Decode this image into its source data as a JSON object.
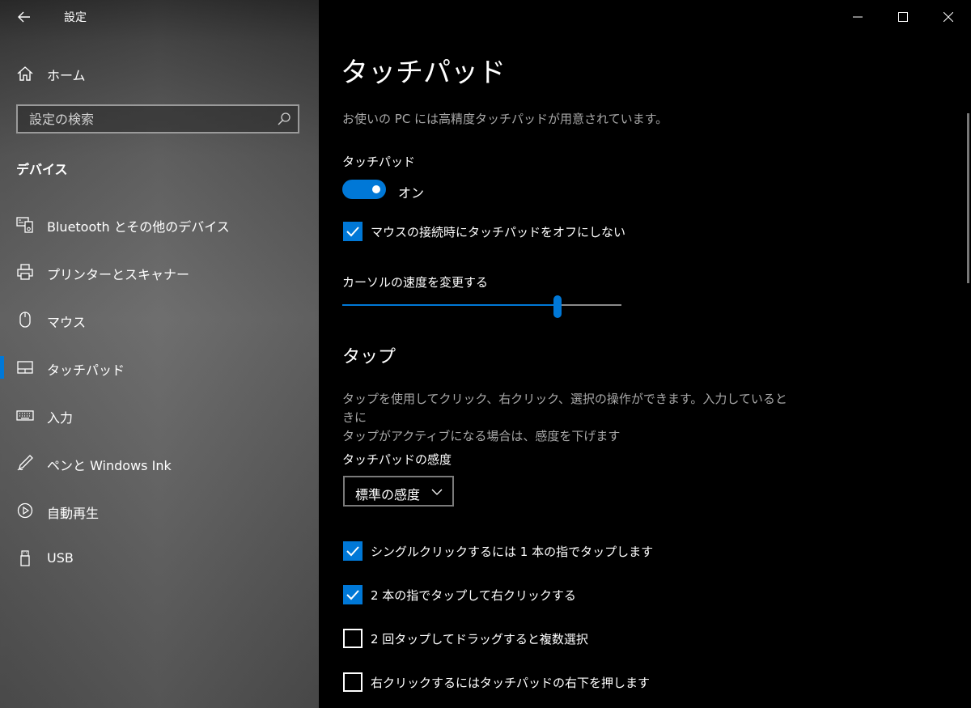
{
  "window": {
    "title": "設定"
  },
  "sidebar": {
    "home_label": "ホーム",
    "search_placeholder": "設定の検索",
    "section": "デバイス",
    "items": [
      {
        "label": "Bluetooth とその他のデバイス",
        "icon": "bluetooth-devices-icon",
        "active": false
      },
      {
        "label": "プリンターとスキャナー",
        "icon": "printer-icon",
        "active": false
      },
      {
        "label": "マウス",
        "icon": "mouse-icon",
        "active": false
      },
      {
        "label": "タッチパッド",
        "icon": "touchpad-icon",
        "active": true
      },
      {
        "label": "入力",
        "icon": "keyboard-icon",
        "active": false
      },
      {
        "label": "ペンと Windows Ink",
        "icon": "pen-icon",
        "active": false
      },
      {
        "label": "自動再生",
        "icon": "autoplay-icon",
        "active": false
      },
      {
        "label": "USB",
        "icon": "usb-icon",
        "active": false
      }
    ]
  },
  "main": {
    "title": "タッチパッド",
    "subtitle": "お使いの PC には高精度タッチパッドが用意されています。",
    "touchpad_label": "タッチパッド",
    "toggle_state": "オン",
    "keep_on_with_mouse": "マウスの接続時にタッチパッドをオフにしない",
    "cursor_speed_label": "カーソルの速度を変更する",
    "cursor_speed_value": 0.77,
    "tap_section": "タップ",
    "tap_description_1": "タップを使用してクリック、右クリック、選択の操作ができます。入力しているときに",
    "tap_description_2": "タップがアクティブになる場合は、感度を下げます",
    "sensitivity_label": "タッチパッドの感度",
    "sensitivity_value": "標準の感度",
    "options": [
      {
        "label": "シングルクリックするには 1 本の指でタップします",
        "checked": true
      },
      {
        "label": "2 本の指でタップして右クリックする",
        "checked": true
      },
      {
        "label": "2 回タップしてドラッグすると複数選択",
        "checked": false
      },
      {
        "label": "右クリックするにはタッチパッドの右下を押します",
        "checked": false
      }
    ]
  },
  "colors": {
    "accent": "#0078d7",
    "background": "#000000"
  }
}
